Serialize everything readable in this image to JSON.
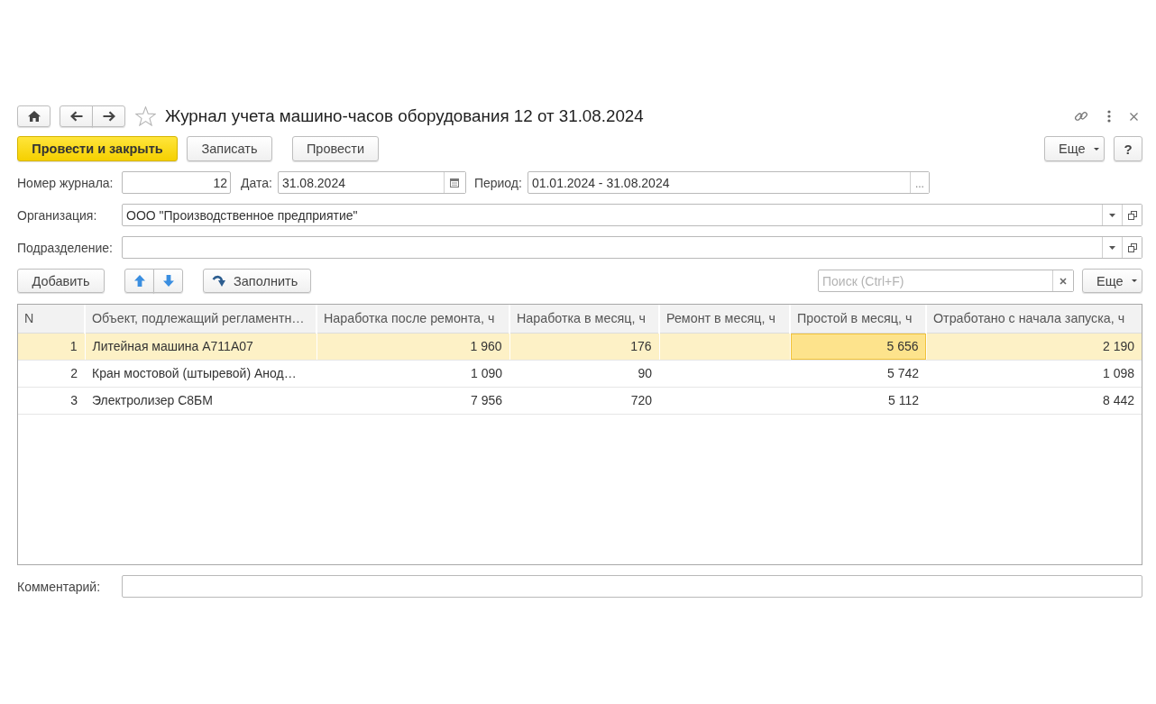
{
  "header": {
    "title": "Журнал учета машино-часов оборудования 12 от 31.08.2024",
    "favorite": false
  },
  "commands": {
    "buttons": [
      {
        "label": "Провести и закрыть",
        "kind": "primary"
      },
      {
        "label": "Записать",
        "kind": "default"
      },
      {
        "label": "Провести",
        "kind": "default"
      }
    ],
    "more": "Еще",
    "help": "?"
  },
  "fields": {
    "journal_number": {
      "label": "Номер журнала:",
      "value": "12"
    },
    "date": {
      "label": "Дата:",
      "value": "31.08.2024"
    },
    "period": {
      "label": "Период:",
      "value": "01.01.2024 - 31.08.2024",
      "button": "..."
    },
    "organization": {
      "label": "Организация:",
      "value": "ООО \"Производственное предприятие\""
    },
    "department": {
      "label": "Подразделение:"
    }
  },
  "table_toolbar": {
    "add": "Добавить",
    "fill": "Заполнить",
    "search": {
      "placeholder": "Поиск (Ctrl+F)"
    },
    "more": "Еще"
  },
  "table": {
    "columns": [
      {
        "label": "N",
        "kind": "number"
      },
      {
        "label": "Объект, подлежащий регламентн…",
        "kind": "text"
      },
      {
        "label": "Наработка после ремонта, ч",
        "kind": "number"
      },
      {
        "label": "Наработка в месяц, ч",
        "kind": "number"
      },
      {
        "label": "Ремонт в месяц, ч",
        "kind": "number"
      },
      {
        "label": "Простой в месяц, ч",
        "kind": "number"
      },
      {
        "label": "Отработано с начала запуска, ч",
        "kind": "number"
      }
    ],
    "rows": [
      {
        "selected": true,
        "cells": [
          {
            "text": "1",
            "selected": false
          },
          {
            "text": "Литейная машина А711А07",
            "selected": false
          },
          {
            "text": "1 960",
            "selected": false
          },
          {
            "text": "176",
            "selected": false
          },
          {
            "selected": false
          },
          {
            "text": "5 656",
            "selected": true
          },
          {
            "text": "2 190",
            "selected": false
          }
        ]
      },
      {
        "selected": false,
        "cells": [
          {
            "text": "2",
            "selected": false
          },
          {
            "text": "Кран мостовой (штыревой) Анод…",
            "selected": false
          },
          {
            "text": "1 090",
            "selected": false
          },
          {
            "text": "90",
            "selected": false
          },
          {
            "selected": false
          },
          {
            "text": "5 742",
            "selected": false
          },
          {
            "text": "1 098",
            "selected": false
          }
        ]
      },
      {
        "selected": false,
        "cells": [
          {
            "text": "3",
            "selected": false
          },
          {
            "text": "Электролизер С8БМ",
            "selected": false
          },
          {
            "text": "7 956",
            "selected": false
          },
          {
            "text": "720",
            "selected": false
          },
          {
            "selected": false
          },
          {
            "text": "5 112",
            "selected": false
          },
          {
            "text": "8 442",
            "selected": false
          }
        ]
      }
    ]
  },
  "comment": {
    "label": "Комментарий:"
  }
}
